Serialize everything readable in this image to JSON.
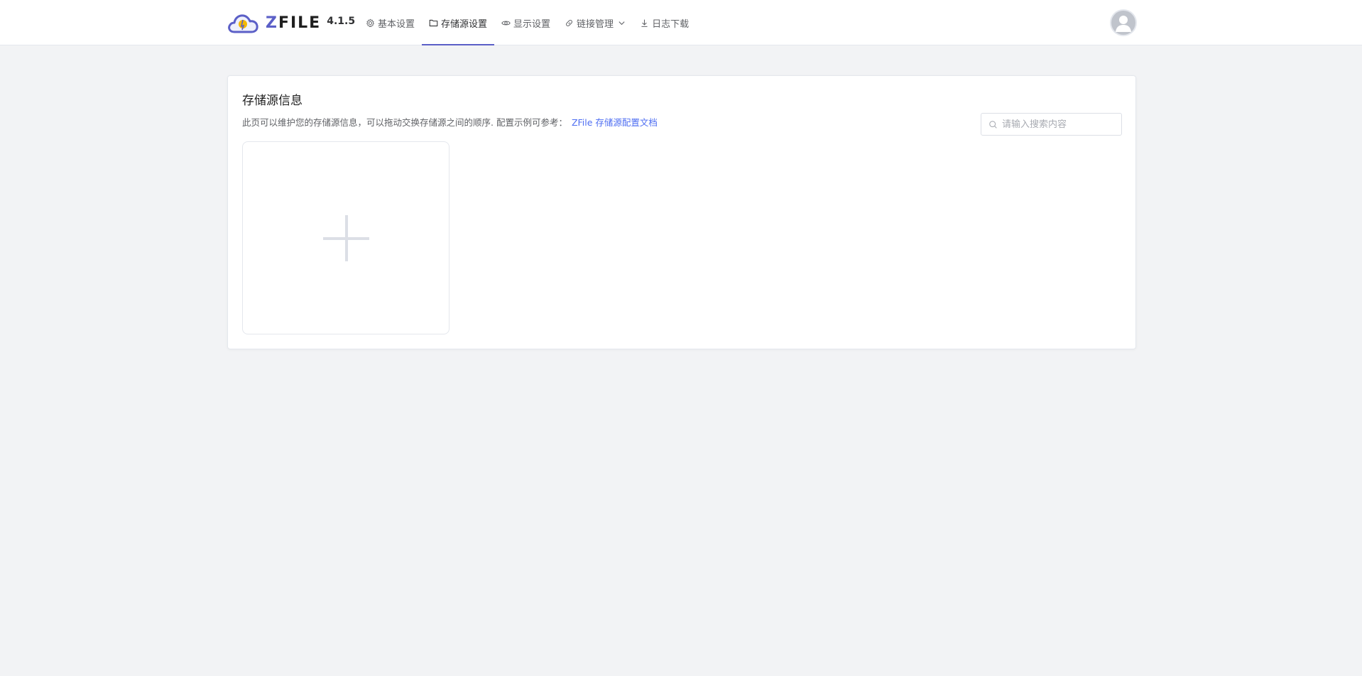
{
  "header": {
    "brand_name_first": "Z",
    "brand_name_rest": "FILE",
    "version": "4.1.5",
    "nav": [
      {
        "label": "基本设置",
        "icon": "gear-icon"
      },
      {
        "label": "存储源设置",
        "icon": "folder-icon",
        "active": true
      },
      {
        "label": "显示设置",
        "icon": "eye-icon"
      },
      {
        "label": "链接管理",
        "icon": "link-icon",
        "has_dropdown": true
      },
      {
        "label": "日志下载",
        "icon": "download-icon"
      }
    ]
  },
  "main": {
    "title": "存储源信息",
    "description": "此页可以维护您的存储源信息，可以拖动交换存储源之间的顺序. 配置示例可参考：",
    "doc_link": "ZFile 存储源配置文档",
    "search_placeholder": "请输入搜索内容"
  },
  "colors": {
    "accent": "#5b5fc7",
    "link": "#4e6ef2",
    "background": "#f2f3f5"
  }
}
